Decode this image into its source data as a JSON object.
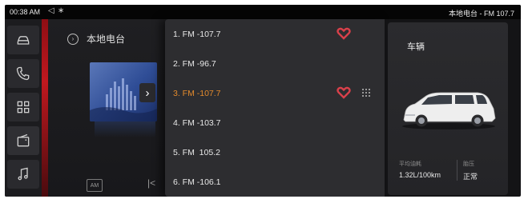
{
  "statusbar": {
    "time": "00:38 AM",
    "icons": [
      "volume-icon",
      "bluetooth-icon"
    ],
    "now_playing": "本地电台 - FM 107.7"
  },
  "dock": {
    "items": [
      {
        "name": "car-icon"
      },
      {
        "name": "phone-icon"
      },
      {
        "name": "apps-grid-icon"
      },
      {
        "name": "radio-icon",
        "active": true
      },
      {
        "name": "music-icon"
      }
    ]
  },
  "radio": {
    "title": "本地电台",
    "am_label": "AM",
    "next_glyph": "›",
    "prev_glyph": "|<"
  },
  "stations": [
    {
      "label": "1. FM -107.7",
      "favorite": true,
      "selected": false
    },
    {
      "label": "2. FM -96.7",
      "favorite": false,
      "selected": false
    },
    {
      "label": "3. FM -107.7",
      "favorite": true,
      "selected": true
    },
    {
      "label": "4. FM -103.7",
      "favorite": false,
      "selected": false
    },
    {
      "label": "5. FM  105.2",
      "favorite": false,
      "selected": false
    },
    {
      "label": "6. FM -106.1",
      "favorite": false,
      "selected": false
    }
  ],
  "vehicle": {
    "title": "车辆",
    "fuel_label": "平均油耗",
    "fuel_value": "1.32L/100km",
    "tire_label": "胎压",
    "tire_value": "正常"
  },
  "colors": {
    "accent_red": "#c0181f",
    "heart_red": "#d9404a",
    "selected_orange": "#e38a2c",
    "background": "#141416"
  }
}
